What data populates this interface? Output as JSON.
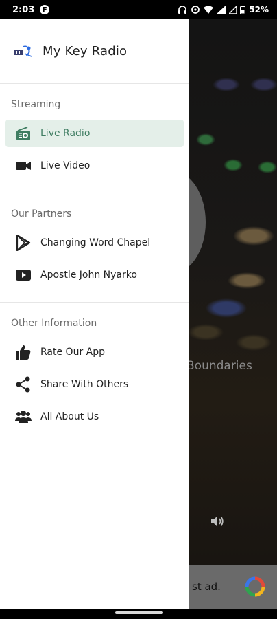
{
  "status_bar": {
    "time": "2:03",
    "app_badge": "F",
    "battery": "52%"
  },
  "drawer": {
    "app_title": "My Key Radio",
    "sections": [
      {
        "title": "Streaming",
        "items": [
          {
            "label": "Live Radio",
            "icon": "radio-icon",
            "active": true
          },
          {
            "label": "Live Video",
            "icon": "video-camera-icon",
            "active": false
          }
        ]
      },
      {
        "title": "Our Partners",
        "items": [
          {
            "label": "Changing Word Chapel",
            "icon": "play-store-icon",
            "active": false
          },
          {
            "label": "Apostle John Nyarko",
            "icon": "youtube-icon",
            "active": false
          }
        ]
      },
      {
        "title": "Other Information",
        "items": [
          {
            "label": "Rate Our App",
            "icon": "thumbs-up-icon",
            "active": false
          },
          {
            "label": "Share With Others",
            "icon": "share-icon",
            "active": false
          },
          {
            "label": "All About Us",
            "icon": "people-icon",
            "active": false
          }
        ]
      }
    ]
  },
  "background": {
    "caption": "Boundaries",
    "ad_text": "st ad."
  },
  "colors": {
    "accent": "#3f7d62",
    "active_bg": "#e4efe9"
  }
}
